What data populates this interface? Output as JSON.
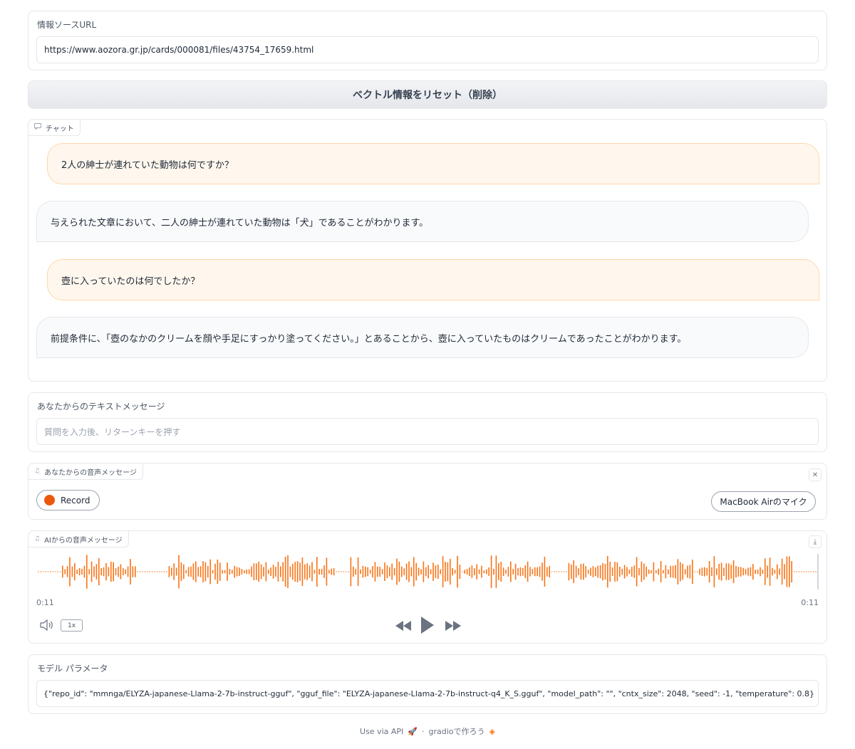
{
  "source": {
    "label": "情報ソースURL",
    "value": "https://www.aozora.gr.jp/cards/000081/files/43754_17659.html"
  },
  "reset_button": {
    "label": "ベクトル情報をリセット（削除）"
  },
  "chat": {
    "label": "チャット",
    "icon": "chat-icon",
    "messages": [
      {
        "role": "user",
        "text": "2人の紳士が連れていた動物は何ですか？"
      },
      {
        "role": "bot",
        "text": "与えられた文章において、二人の紳士が連れていた動物は「犬」であることがわかります。"
      },
      {
        "role": "user",
        "text": "壺に入っていたのは何でしたか？"
      },
      {
        "role": "bot",
        "text": "前提条件に、「壺のなかのクリームを顔や手足にすっかり塗ってください。」とあることから、壺に入っていたものはクリームであったことがわかります。"
      }
    ]
  },
  "text_message": {
    "label": "あなたからのテキストメッセージ",
    "placeholder": "質問を入力後、リターンキーを押す"
  },
  "voice_input": {
    "label": "あなたからの音声メッセージ",
    "icon": "music-note-icon",
    "record_label": "Record",
    "mic_label": "MacBook Airのマイク"
  },
  "ai_audio": {
    "label": "AIからの音声メッセージ",
    "icon": "music-note-icon",
    "time_current": "0:11",
    "time_total": "0:11",
    "speed": "1x",
    "waveform_color": "#f97316"
  },
  "model_params": {
    "label": "モデル パラメータ",
    "value": "{\"repo_id\": \"mmnga/ELYZA-japanese-Llama-2-7b-instruct-gguf\", \"gguf_file\": \"ELYZA-japanese-Llama-2-7b-instruct-q4_K_S.gguf\", \"model_path\": \"\", \"cntx_size\": 2048, \"seed\": -1, \"temperature\": 0.8}"
  },
  "footer": {
    "api_label": "Use via API",
    "separator": "·",
    "built_with": "gradioで作ろう"
  },
  "colors": {
    "accent": "#f97316",
    "user_bubble": "#fff7ed",
    "bot_bubble": "#f9fafb"
  }
}
